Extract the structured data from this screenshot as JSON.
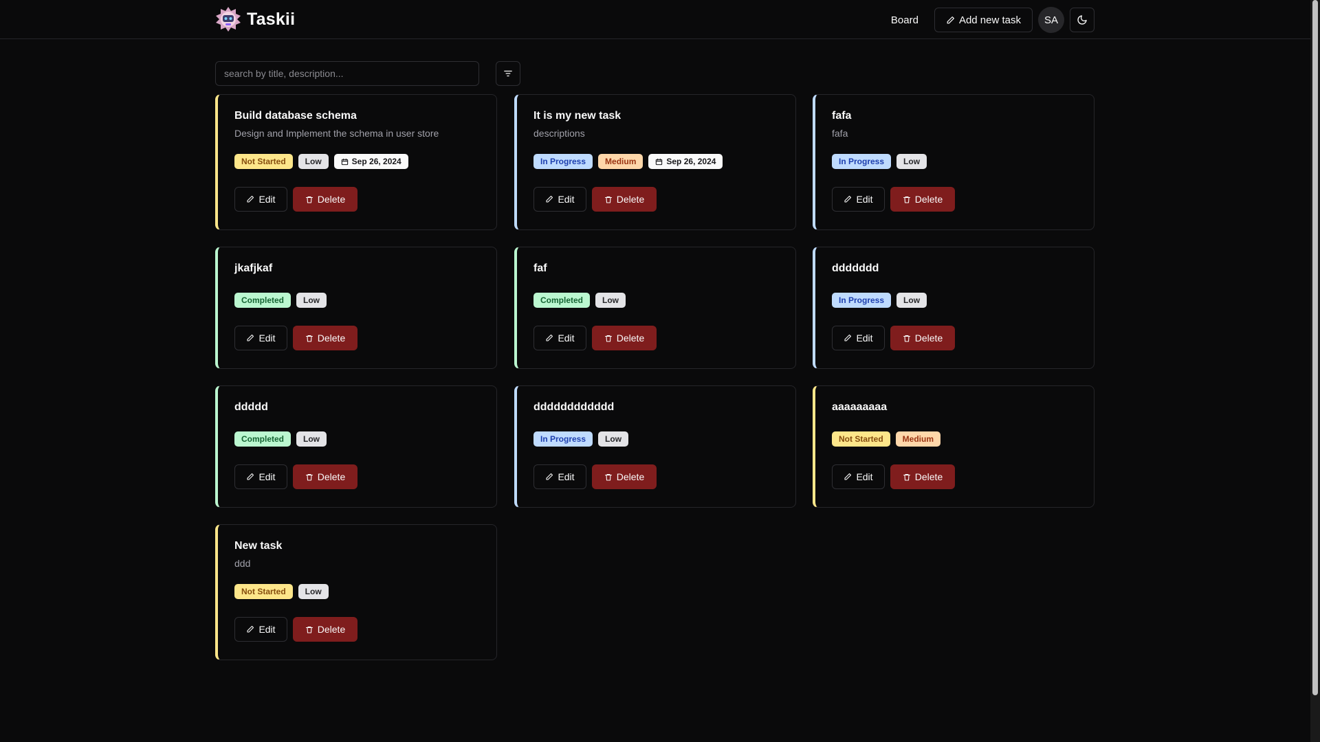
{
  "app": {
    "name": "Taskii"
  },
  "nav": {
    "board_label": "Board",
    "add_label": "Add new task",
    "avatar_initials": "SA"
  },
  "search": {
    "placeholder": "search by title, description..."
  },
  "colors": {
    "not_started": "#fde68a",
    "in_progress": "#bfdbfe",
    "completed": "#bbf7d0",
    "low": "#e4e4e7",
    "medium": "#fed7aa",
    "delete": "#7f1d1d"
  },
  "actions": {
    "edit_label": "Edit",
    "delete_label": "Delete"
  },
  "tasks": [
    {
      "title": "Build database schema",
      "description": "Design and Implement the schema in user store",
      "status": "Not Started",
      "priority": "Low",
      "date": "Sep 26, 2024"
    },
    {
      "title": "It is my new task",
      "description": "descriptions",
      "status": "In Progress",
      "priority": "Medium",
      "date": "Sep 26, 2024"
    },
    {
      "title": "fafa",
      "description": "fafa",
      "status": "In Progress",
      "priority": "Low",
      "date": ""
    },
    {
      "title": "jkafjkaf",
      "description": "",
      "status": "Completed",
      "priority": "Low",
      "date": ""
    },
    {
      "title": "faf",
      "description": "",
      "status": "Completed",
      "priority": "Low",
      "date": ""
    },
    {
      "title": "ddddddd",
      "description": "",
      "status": "In Progress",
      "priority": "Low",
      "date": ""
    },
    {
      "title": "ddddd",
      "description": "",
      "status": "Completed",
      "priority": "Low",
      "date": ""
    },
    {
      "title": "dddddddddddd",
      "description": "",
      "status": "In Progress",
      "priority": "Low",
      "date": ""
    },
    {
      "title": "aaaaaaaaa",
      "description": "",
      "status": "Not Started",
      "priority": "Medium",
      "date": ""
    },
    {
      "title": "New task",
      "description": "ddd",
      "status": "Not Started",
      "priority": "Low",
      "date": ""
    }
  ]
}
